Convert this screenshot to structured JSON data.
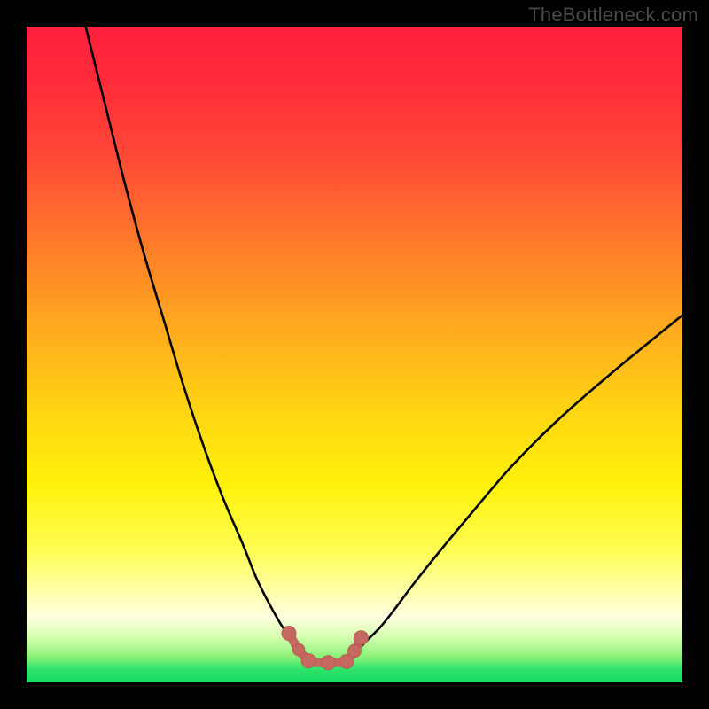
{
  "watermark": {
    "text": "TheBottleneck.com"
  },
  "colors": {
    "black": "#000000",
    "curve": "#000000",
    "marker": "#c66a61",
    "marker_edge": "#b65a52"
  },
  "chart_data": {
    "type": "line",
    "title": "",
    "xlabel": "",
    "ylabel": "",
    "xlim": [
      0,
      100
    ],
    "ylim": [
      0,
      100
    ],
    "grid": false,
    "legend": false,
    "series": [
      {
        "name": "left-curve",
        "x": [
          9,
          12,
          15,
          18,
          21,
          24,
          27,
          30,
          33,
          35,
          37,
          39,
          40.5,
          42,
          43
        ],
        "y": [
          100,
          88,
          76,
          65,
          55,
          45,
          36,
          28,
          21,
          16,
          12,
          8.5,
          6.5,
          5,
          4
        ]
      },
      {
        "name": "right-curve",
        "x": [
          49,
          50.5,
          52,
          54,
          56,
          59,
          63,
          68,
          74,
          81,
          89,
          100
        ],
        "y": [
          4,
          5,
          6.5,
          8.5,
          11,
          15,
          20,
          26,
          33,
          40,
          47,
          56
        ]
      }
    ],
    "markers": [
      {
        "name": "left-knee-top",
        "x": 40.0,
        "y": 7.5,
        "r": 1.2
      },
      {
        "name": "left-knee-mid",
        "x": 41.5,
        "y": 5.0,
        "r": 1.0
      },
      {
        "name": "flat-start",
        "x": 43.0,
        "y": 3.3,
        "r": 1.2
      },
      {
        "name": "flat-mid",
        "x": 46.0,
        "y": 3.0,
        "r": 1.2
      },
      {
        "name": "flat-end",
        "x": 48.8,
        "y": 3.2,
        "r": 1.2
      },
      {
        "name": "right-knee-mid",
        "x": 50.0,
        "y": 4.8,
        "r": 1.1
      },
      {
        "name": "right-knee-top",
        "x": 51.0,
        "y": 6.8,
        "r": 1.2
      }
    ],
    "marker_connector": {
      "name": "bottom-connector",
      "x": [
        40.0,
        41.5,
        43.0,
        44.5,
        46.0,
        47.5,
        48.8,
        50.0,
        51.0
      ],
      "y": [
        7.5,
        5.0,
        3.3,
        3.0,
        3.0,
        3.0,
        3.2,
        4.8,
        6.8
      ]
    }
  }
}
